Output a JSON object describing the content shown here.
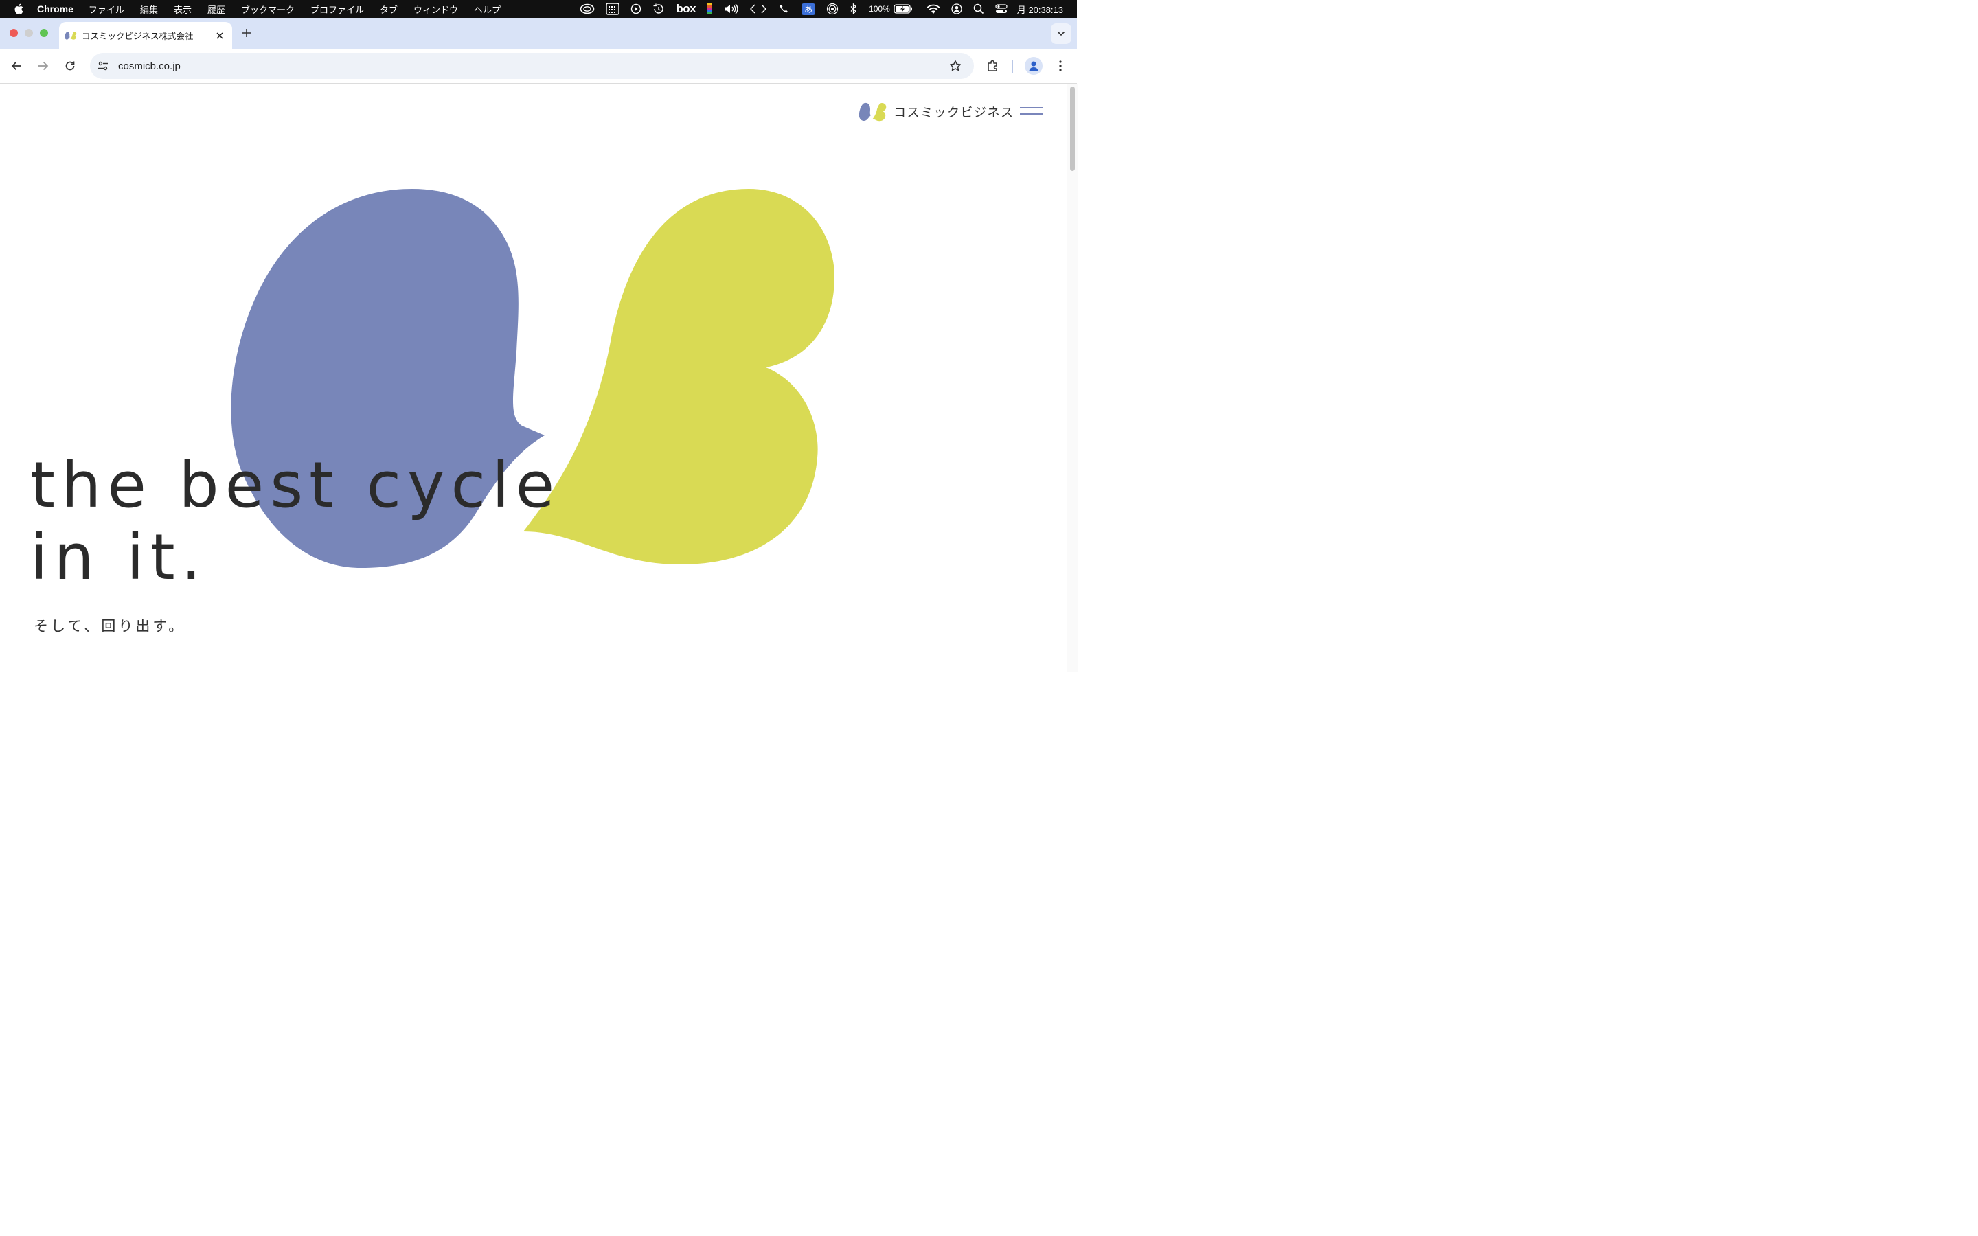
{
  "menubar": {
    "app_name": "Chrome",
    "items": [
      "ファイル",
      "編集",
      "表示",
      "履歴",
      "ブックマーク",
      "プロファイル",
      "タブ",
      "ウィンドウ",
      "ヘルプ"
    ],
    "battery": "100%",
    "ime": "あ",
    "clock": "月 20:38:13",
    "box_label": "box"
  },
  "tab": {
    "title": "コスミックビジネス株式会社"
  },
  "omnibox": {
    "url": "cosmicb.co.jp"
  },
  "site": {
    "logo_text": "コスミックビジネス",
    "tagline_line1": "the best cycle",
    "tagline_line2": "in it.",
    "subtagline": "そして、回り出す。"
  },
  "colors": {
    "brand_blue": "#7886b9",
    "brand_yellow": "#d9da54",
    "text_dark": "#2b2b2b"
  },
  "icons": [
    "apple-icon",
    "creative-cloud-icon",
    "calendar-grid-icon",
    "play-icon",
    "time-machine-icon",
    "box-icon",
    "color-bars-icon",
    "volume-icon",
    "code-arrows-icon",
    "phone-icon",
    "airdrop-icon",
    "bluetooth-icon",
    "battery-icon",
    "wifi-icon",
    "user-icon",
    "search-icon",
    "control-center-icon"
  ]
}
